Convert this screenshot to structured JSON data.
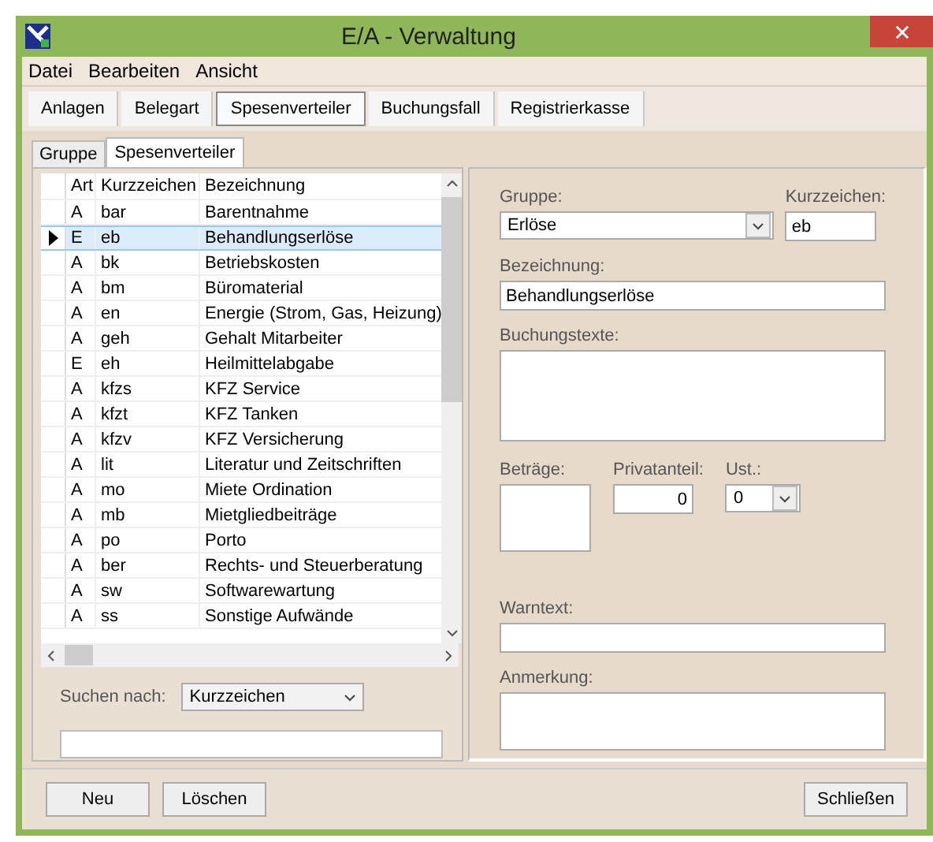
{
  "window": {
    "title": "E/A - Verwaltung"
  },
  "menu": [
    "Datei",
    "Bearbeiten",
    "Ansicht"
  ],
  "toolbar_tabs": [
    {
      "label": "Anlagen",
      "selected": false
    },
    {
      "label": "Belegart",
      "selected": false
    },
    {
      "label": "Spesenverteiler",
      "selected": true
    },
    {
      "label": "Buchungsfall",
      "selected": false
    },
    {
      "label": "Registrierkasse",
      "selected": false
    }
  ],
  "sub_tabs": [
    {
      "label": "Gruppe",
      "selected": false
    },
    {
      "label": "Spesenverteiler",
      "selected": true
    }
  ],
  "table": {
    "columns": [
      "Art",
      "Kurzzeichen",
      "Bezeichnung"
    ],
    "rows": [
      {
        "art": "A",
        "kurzzeichen": "bar",
        "bezeichnung": "Barentnahme",
        "selected": false
      },
      {
        "art": "E",
        "kurzzeichen": "eb",
        "bezeichnung": "Behandlungserlöse",
        "selected": true
      },
      {
        "art": "A",
        "kurzzeichen": "bk",
        "bezeichnung": "Betriebskosten",
        "selected": false
      },
      {
        "art": "A",
        "kurzzeichen": "bm",
        "bezeichnung": "Büromaterial",
        "selected": false
      },
      {
        "art": "A",
        "kurzzeichen": "en",
        "bezeichnung": "Energie (Strom, Gas, Heizung)",
        "selected": false
      },
      {
        "art": "A",
        "kurzzeichen": "geh",
        "bezeichnung": "Gehalt Mitarbeiter",
        "selected": false
      },
      {
        "art": "E",
        "kurzzeichen": "eh",
        "bezeichnung": "Heilmittelabgabe",
        "selected": false
      },
      {
        "art": "A",
        "kurzzeichen": "kfzs",
        "bezeichnung": "KFZ Service",
        "selected": false
      },
      {
        "art": "A",
        "kurzzeichen": "kfzt",
        "bezeichnung": "KFZ Tanken",
        "selected": false
      },
      {
        "art": "A",
        "kurzzeichen": "kfzv",
        "bezeichnung": "KFZ Versicherung",
        "selected": false
      },
      {
        "art": "A",
        "kurzzeichen": "lit",
        "bezeichnung": "Literatur und Zeitschriften",
        "selected": false
      },
      {
        "art": "A",
        "kurzzeichen": "mo",
        "bezeichnung": "Miete Ordination",
        "selected": false
      },
      {
        "art": "A",
        "kurzzeichen": "mb",
        "bezeichnung": "Mietgliedbeiträge",
        "selected": false
      },
      {
        "art": "A",
        "kurzzeichen": "po",
        "bezeichnung": "Porto",
        "selected": false
      },
      {
        "art": "A",
        "kurzzeichen": "ber",
        "bezeichnung": "Rechts- und Steuerberatung",
        "selected": false
      },
      {
        "art": "A",
        "kurzzeichen": "sw",
        "bezeichnung": "Softwarewartung",
        "selected": false
      },
      {
        "art": "A",
        "kurzzeichen": "ss",
        "bezeichnung": "Sonstige Aufwände",
        "selected": false
      }
    ]
  },
  "search": {
    "label": "Suchen nach:",
    "by": "Kurzzeichen"
  },
  "details": {
    "gruppe": {
      "label": "Gruppe:",
      "value": "Erlöse"
    },
    "kurzzeichen": {
      "label": "Kurzzeichen:",
      "value": "eb"
    },
    "bezeichnung": {
      "label": "Bezeichnung:",
      "value": "Behandlungserlöse"
    },
    "buchungstexte": {
      "label": "Buchungstexte:"
    },
    "betraege": {
      "label": "Beträge:"
    },
    "privatanteil": {
      "label": "Privatanteil:",
      "value": "0"
    },
    "ust": {
      "label": "Ust.:",
      "value": "0"
    },
    "warntext": {
      "label": "Warntext:"
    },
    "anmerkung": {
      "label": "Anmerkung:"
    }
  },
  "buttons": {
    "left": [
      "Neu",
      "Löschen"
    ],
    "right": [
      "Schließen"
    ]
  }
}
